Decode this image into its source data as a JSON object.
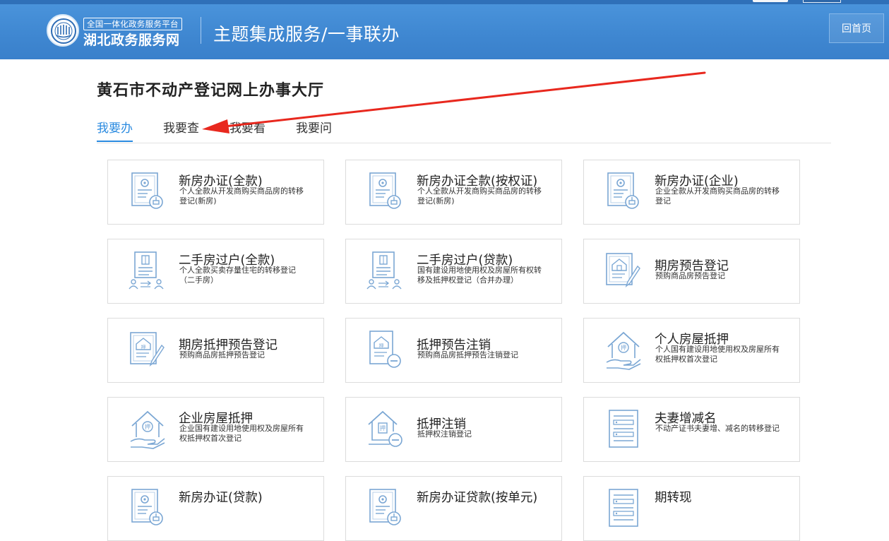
{
  "header": {
    "logo_top": "全国一体化政务服务平台",
    "logo_main": "湖北政务服务网",
    "title": "主题集成服务/一事联办",
    "home_button": "回首页",
    "colors": {
      "bar": "#3f87d1",
      "accent": "#2b8be0",
      "icon": "#7ba7d4",
      "arrow": "#e8281e"
    }
  },
  "page_title": "黄石市不动产登记网上办事大厅",
  "tabs": [
    {
      "label": "我要办",
      "active": true
    },
    {
      "label": "我要查",
      "active": false
    },
    {
      "label": "我要看",
      "active": false
    },
    {
      "label": "我要问",
      "active": false
    }
  ],
  "cards": [
    {
      "title": "新房办证(全款)",
      "desc": "个人全款从开发商购买商品房的转移登记(新房)",
      "icon": "certificate-stamp-icon"
    },
    {
      "title": "新房办证全款(按权证)",
      "desc": "个人全款从开发商购买商品房的转移登记(新房)",
      "icon": "certificate-stamp-icon"
    },
    {
      "title": "新房办证(企业)",
      "desc": "企业全款从开发商购买商品房的转移登记",
      "icon": "certificate-stamp-icon"
    },
    {
      "title": "二手房过户(全款)",
      "desc": "个人全款买卖存量住宅的转移登记（二手房）",
      "icon": "transfer-document-icon"
    },
    {
      "title": "二手房过户(贷款)",
      "desc": "国有建设用地使用权及房屋所有权转移及抵押权登记（合并办理）",
      "icon": "transfer-document-icon"
    },
    {
      "title": "期房预告登记",
      "desc": "预购商品房预告登记",
      "icon": "house-document-pen-icon"
    },
    {
      "title": "期房抵押预告登记",
      "desc": "预购商品房抵押预告登记",
      "icon": "mortgage-document-pen-icon"
    },
    {
      "title": "抵押预告注销",
      "desc": "预购商品房抵押预告注销登记",
      "icon": "document-cancel-icon"
    },
    {
      "title": "个人房屋抵押",
      "desc": "个人国有建设用地使用权及房屋所有权抵押权首次登记",
      "icon": "house-mortgage-hand-icon"
    },
    {
      "title": "企业房屋抵押",
      "desc": "企业国有建设用地使用权及房屋所有权抵押权首次登记",
      "icon": "house-mortgage-hand-icon"
    },
    {
      "title": "抵押注销",
      "desc": "抵押权注销登记",
      "icon": "house-cancel-icon"
    },
    {
      "title": "夫妻增减名",
      "desc": "不动产证书夫妻增、减名的转移登记",
      "icon": "form-list-icon"
    },
    {
      "title": "新房办证(贷款)",
      "desc": "",
      "icon": "certificate-stamp-icon"
    },
    {
      "title": "新房办证贷款(按单元)",
      "desc": "",
      "icon": "certificate-stamp-icon"
    },
    {
      "title": "期转现",
      "desc": "",
      "icon": "form-list-icon"
    }
  ]
}
